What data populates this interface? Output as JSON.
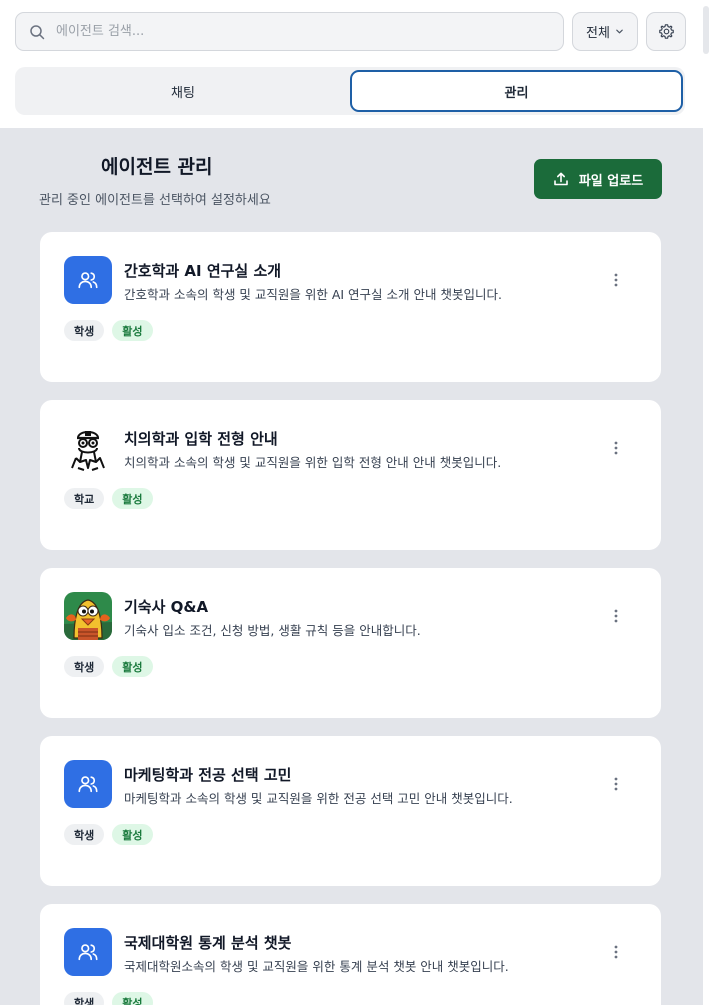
{
  "search": {
    "placeholder": "에이전트 검색..."
  },
  "filter": {
    "label": "전체"
  },
  "tabs": [
    {
      "label": "채팅",
      "active": false
    },
    {
      "label": "관리",
      "active": true
    }
  ],
  "header": {
    "title": "에이전트 관리",
    "subtitle": "관리 중인 에이전트를 선택하여 설정하세요",
    "upload_label": "파일 업로드"
  },
  "agents": [
    {
      "name": "간호학과 AI 연구실 소개",
      "description": "간호학과 소속의 학생 및 교직원을 위한 AI 연구실 소개 안내 챗봇입니다.",
      "tag": "학생",
      "status": "활성",
      "icon": "users-icon"
    },
    {
      "name": "치의학과 입학 전형 안내",
      "description": "치의학과 소속의 학생 및 교직원을 위한 입학 전형 안내 안내 챗봇입니다.",
      "tag": "학교",
      "status": "활성",
      "icon": "doctor-character-icon"
    },
    {
      "name": "기숙사 Q&A",
      "description": "기숙사 입소 조건, 신청 방법, 생활 규칙 등을 안내합니다.",
      "tag": "학생",
      "status": "활성",
      "icon": "bird-character-icon"
    },
    {
      "name": "마케팅학과 전공 선택 고민",
      "description": "마케팅학과 소속의 학생 및 교직원을 위한 전공 선택 고민 안내 챗봇입니다.",
      "tag": "학생",
      "status": "활성",
      "icon": "users-icon"
    },
    {
      "name": "국제대학원 통계 분석 챗봇",
      "description": "국제대학원소속의 학생 및 교직원을 위한 통계 분석 챗봇 안내 챗봇입니다.",
      "tag": "학생",
      "status": "활성",
      "icon": "users-icon"
    }
  ],
  "colors": {
    "primary": "#1b6b3a",
    "accent_blue": "#2f6fe4",
    "tab_border": "#1e5fa6",
    "status_green": "#1a7a3d"
  }
}
